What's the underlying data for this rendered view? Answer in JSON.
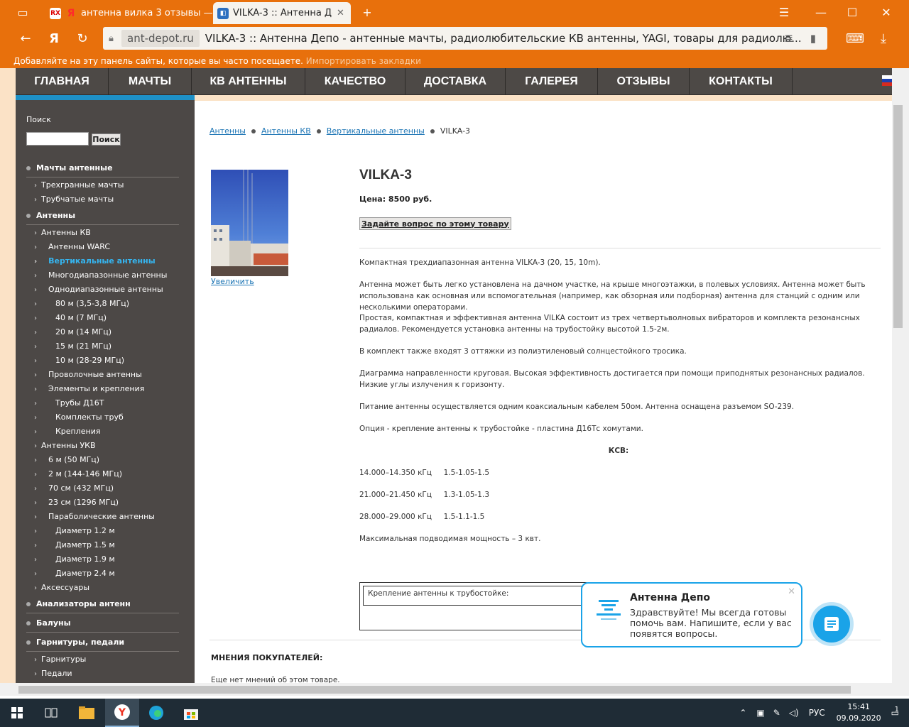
{
  "browser": {
    "tabs": [
      {
        "label": "антенна вилка 3 отзывы —",
        "favicon": "yandex-icon"
      },
      {
        "label": "VILKA-3 :: Антенна Депо",
        "favicon": "site-icon"
      }
    ],
    "address": {
      "domain": "ant-depot.ru",
      "title": "VILKA-3 :: Антенна Депо - антенные мачты, радиолюбительские КВ антенны, YAGI, товары для радиолю..."
    },
    "bookmarks_hint": "Добавляйте на эту панель сайты, которые вы часто посещаете.",
    "bookmarks_import": "Импортировать закладки",
    "accent_color": "#e8700c"
  },
  "nav": {
    "items": [
      "ГЛАВНАЯ",
      "МАЧТЫ",
      "КВ АНТЕННЫ",
      "КАЧЕСТВО",
      "ДОСТАВКА",
      "ГАЛЕРЕЯ",
      "ОТЗЫВЫ",
      "КОНТАКТЫ"
    ]
  },
  "sidebar": {
    "search_label": "Поиск",
    "search_button": "Поиск",
    "categories": [
      {
        "label": "Мачты антенные",
        "items": [
          "Трехгранные мачты",
          "Трубчатые мачты"
        ]
      },
      {
        "label": "Антенны",
        "items": [
          "Антенны КВ",
          "Антенны WARC",
          "Вертикальные антенны",
          "Многодиапазонные антенны",
          "Однодиапазонные антенны",
          "80 м (3,5-3,8 МГц)",
          "40 м (7 МГц)",
          "20 м (14 МГц)",
          "15 м (21 МГц)",
          "10 м (28-29 МГц)",
          "Проволочные антенны",
          "Элементы и крепления",
          "Трубы Д16Т",
          "Комплекты труб",
          "Крепления",
          "Антенны УКВ",
          "6 м (50 МГц)",
          "2 м (144-146 МГц)",
          "70 см (432 МГц)",
          "23 см (1296 МГц)",
          "Параболические антенны",
          "Диаметр 1.2 м",
          "Диаметр 1.5 м",
          "Диаметр 1.9 м",
          "Диаметр 2.4 м",
          "Аксессуары"
        ]
      },
      {
        "label": "Анализаторы антенн",
        "items": []
      },
      {
        "label": "Балуны",
        "items": []
      },
      {
        "label": "Гарнитуры, педали",
        "items": [
          "Гарнитуры",
          "Педали"
        ]
      }
    ],
    "current_item": "Вертикальные антенны"
  },
  "breadcrumb": [
    "Антенны",
    "Антенны КВ",
    "Вертикальные антенны",
    "VILKA-3"
  ],
  "product": {
    "zoom_link": "Увеличить",
    "title": "VILKA-3",
    "price": "Цена: 8500 руб.",
    "ask_button": "Задайте вопрос по этому товару",
    "description": [
      "Компактная трехдиапазонная антенна VILKA-3 (20, 15, 10m).",
      "Антенна может быть легко установлена на дачном участке, на крыше многоэтажки, в полевых условиях.  Антенна может быть использована как основная или вспомогательная (например, как обзорная или подборная) антенна для станций с одним или несколькими операторами.",
      "Простая, компактная и эффективная антенна VILKA состоит из трех четвертьволновых вибраторов и комплекта резонансных радиалов. Рекомендуется установка антенны на трубостойку высотой 1.5-2м.",
      "В комплект также входят 3 оттяжки из полиэтиленовый солнцестойкого тросика.",
      "Диаграмма направленности круговая. Высокая эффективность достигается при помощи приподнятых резонансных радиалов. Низкие углы излучения к горизонту.",
      "Питание антенны осуществляется одним коаксиальным кабелем 50ом. Антенна оснащена разъемом SO-239.",
      "Опция - крепление антенны к трубостойке - пластина Д16Тс хомутами.",
      "КСВ:",
      "14.000–14.350 кГц     1.5-1.05-1.5",
      "21.000–21.450 кГц     1.3-1.05-1.3",
      "28.000–29.000 кГц     1.5-1.1-1.5",
      "Максимальная подводимая мощность – 3 квт."
    ],
    "mount_option_label": "Крепление антенны к трубостойке:"
  },
  "reviews": {
    "heading": "МНЕНИЯ ПОКУПАТЕЛЕЙ:",
    "empty": "Еще нет мнений об этом товаре."
  },
  "chat": {
    "name": "Антенна Депо",
    "message": "Здравствуйте! Мы всегда готовы помочь вам. Напишите, если у вас появятся вопросы.",
    "color": "#1aa3e8"
  },
  "taskbar": {
    "language": "РУС",
    "time": "15:41",
    "date": "09.09.2020",
    "notifications": "1"
  }
}
